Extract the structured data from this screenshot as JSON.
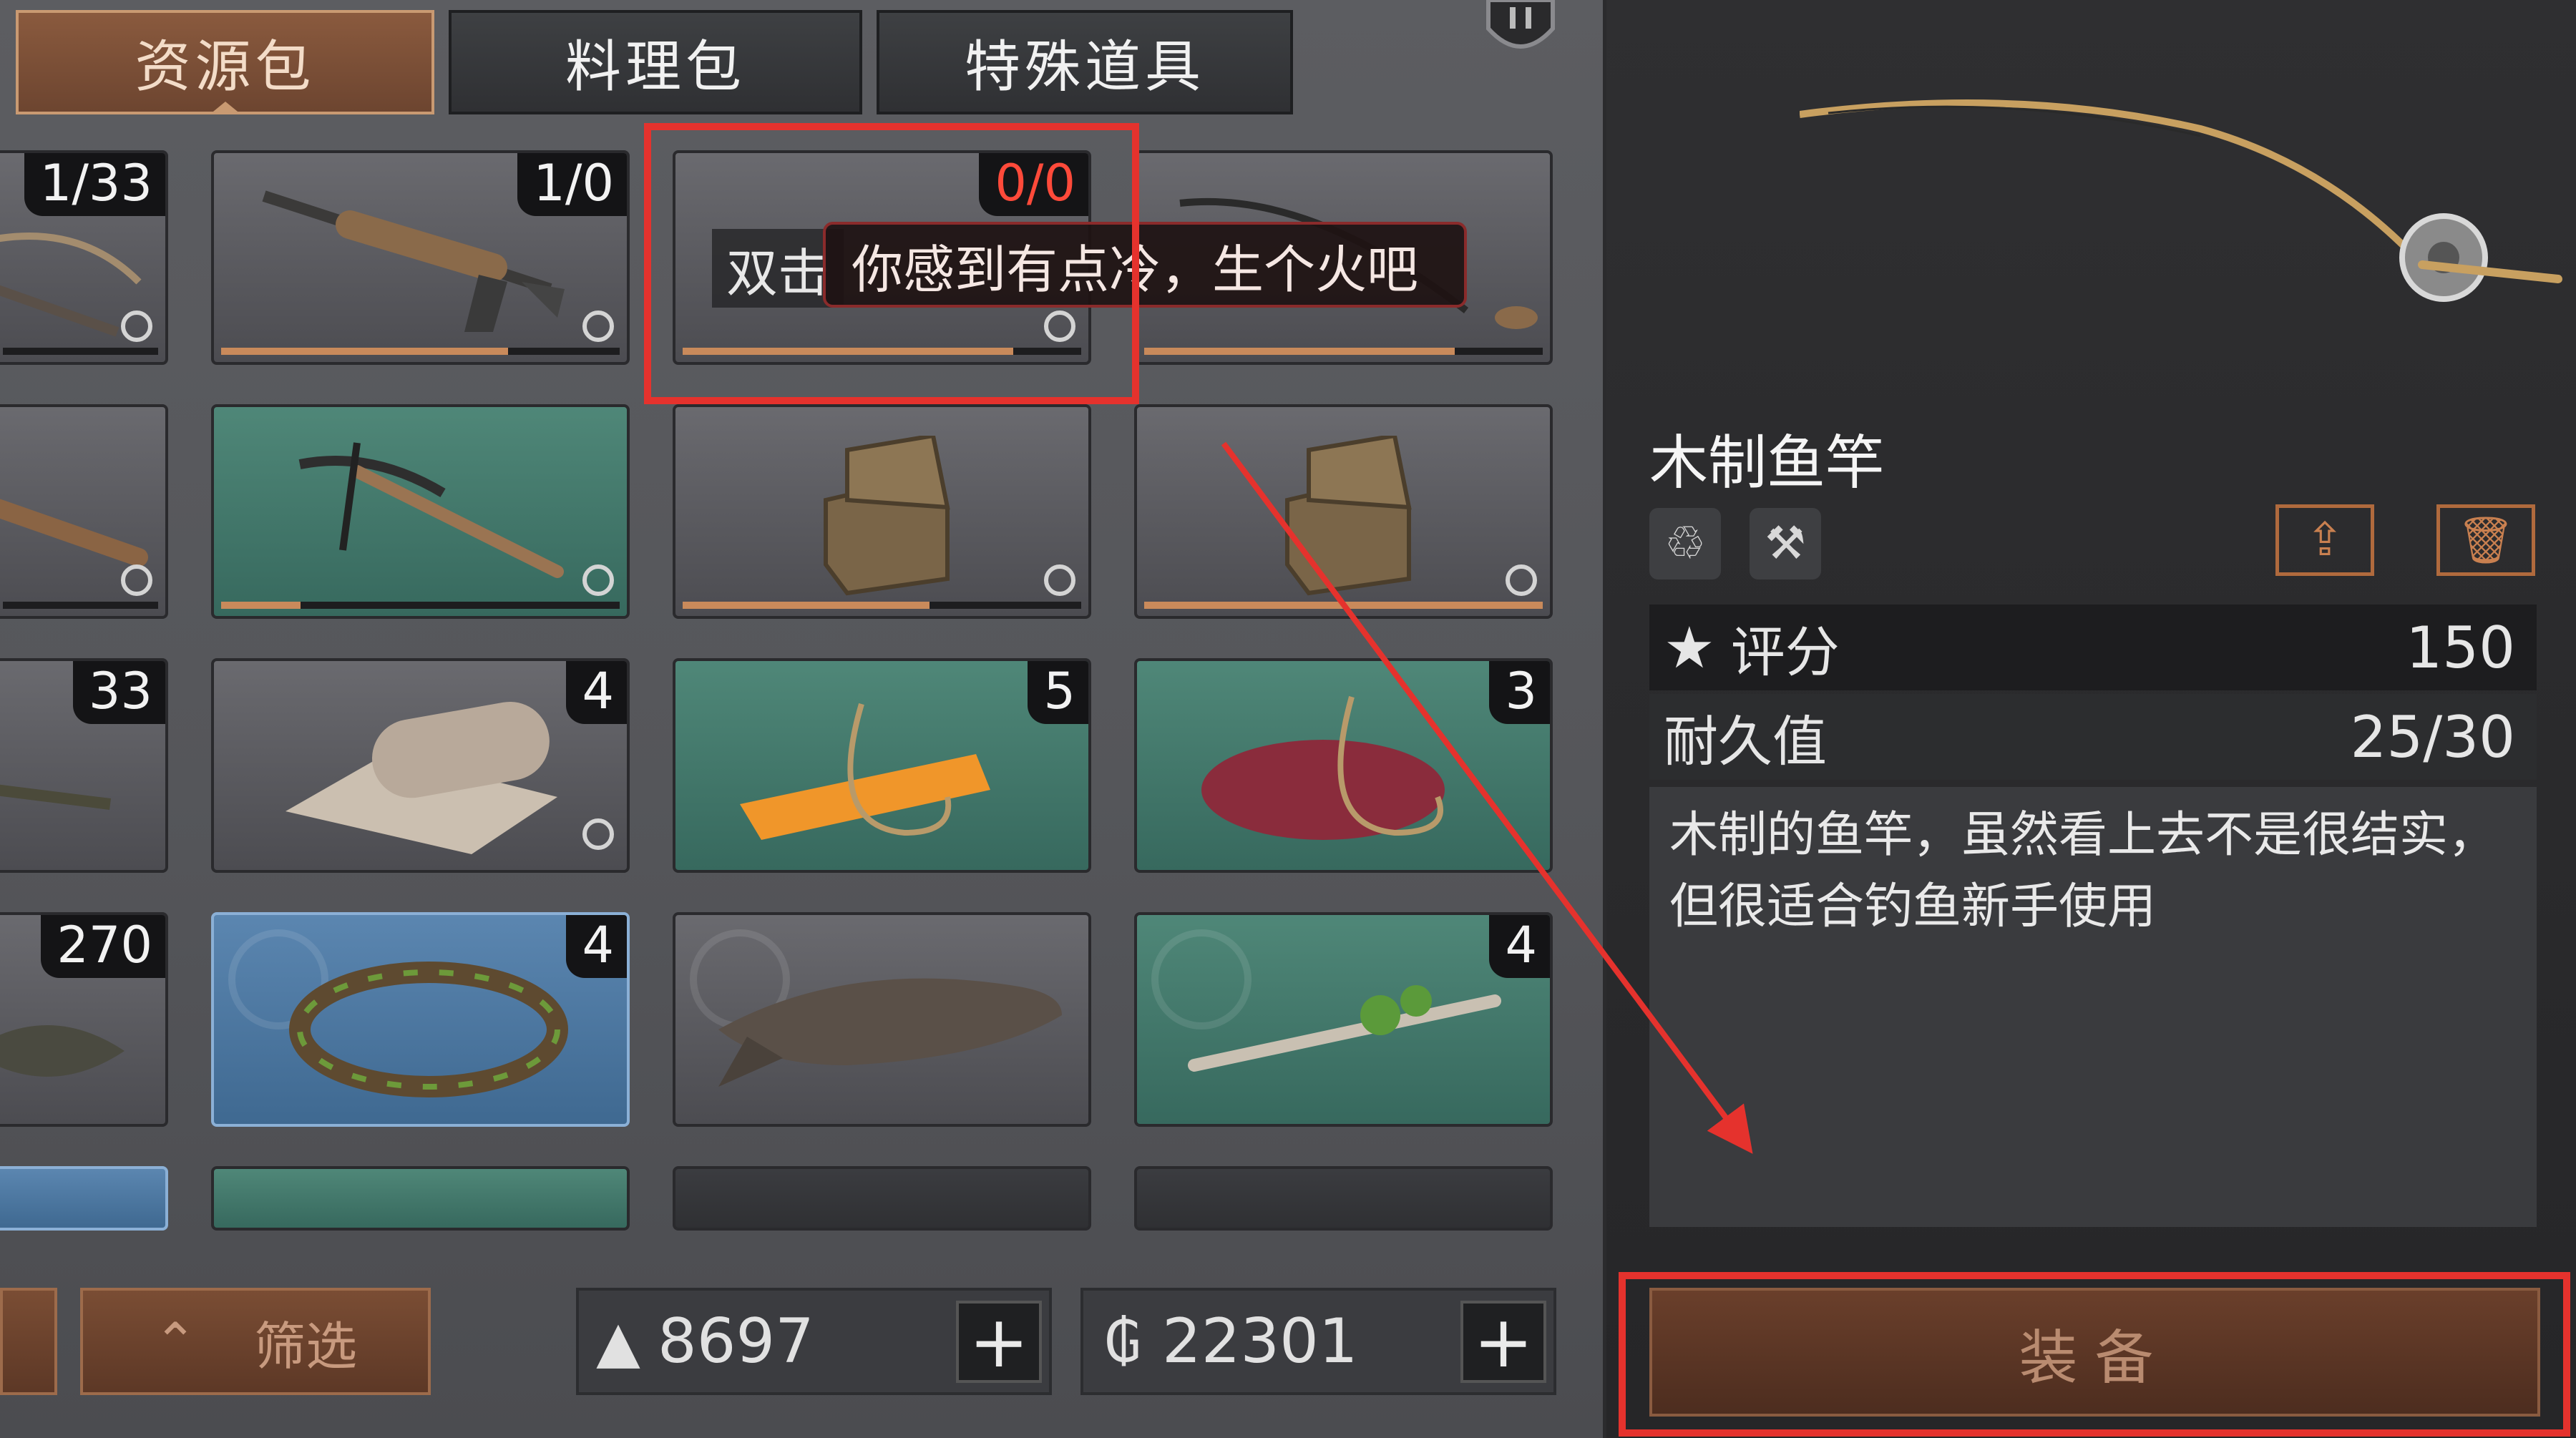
{
  "tabs": [
    {
      "label": "资源包"
    },
    {
      "label": "料理包"
    },
    {
      "label": "特殊道具"
    }
  ],
  "grid": {
    "row1": [
      {
        "count": "1/33"
      },
      {
        "count": "1/0"
      },
      {
        "count": "0/0"
      },
      {
        "count": ""
      }
    ],
    "row3": [
      {
        "count": "33"
      },
      {
        "count": "4"
      },
      {
        "count": "5"
      },
      {
        "count": "3"
      }
    ],
    "row4": [
      {
        "count": "270"
      },
      {
        "count": "4"
      },
      {
        "count": ""
      },
      {
        "count": "4"
      }
    ]
  },
  "tooltip": {
    "hint": "双击",
    "message": "你感到有点冷，生个火吧"
  },
  "bottom": {
    "filter_label": "筛选",
    "currency1": "8697",
    "currency2": "22301",
    "plus": "+"
  },
  "detail": {
    "item_name": "木制鱼竿",
    "rating_label": "评分",
    "rating_value": "150",
    "durability_label": "耐久值",
    "durability_value": "25/30",
    "description": "木制的鱼竿，虽然看上去不是很结实，但很适合钓鱼新手使用",
    "equip_label": "装备"
  },
  "colors": {
    "highlight": "#e5322d",
    "accent": "#b06a3d"
  }
}
